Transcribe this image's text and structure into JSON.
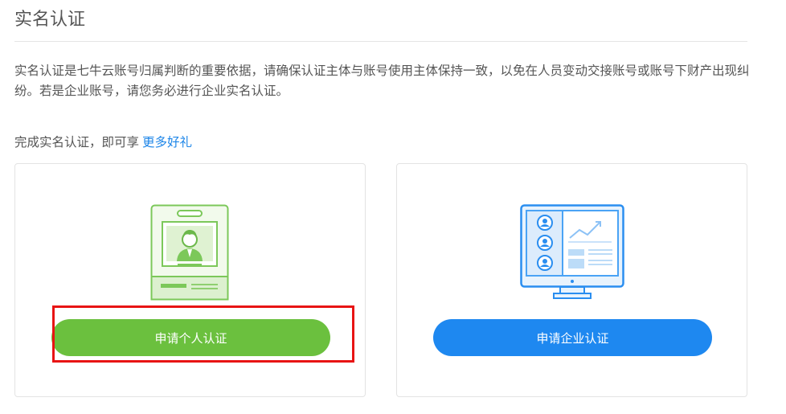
{
  "page": {
    "title": "实名认证",
    "intro": "实名认证是七牛云账号归属判断的重要依据，请确保认证主体与账号使用主体保持一致，以免在人员变动交接账号或账号下财产出现纠纷。若是企业账号，请您务必进行企业实名认证。",
    "benefit_prefix": "完成实名认证，即可享",
    "benefit_link": "更多好礼"
  },
  "cards": {
    "personal": {
      "icon": "id-badge-icon",
      "button_label": "申请个人认证",
      "accent_color": "#6bc03e"
    },
    "enterprise": {
      "icon": "monitor-dashboard-icon",
      "button_label": "申请企业认证",
      "accent_color": "#1e88f0"
    }
  },
  "colors": {
    "link": "#1e86e8",
    "highlight": "#e81414",
    "divider": "#e5e5e5"
  }
}
